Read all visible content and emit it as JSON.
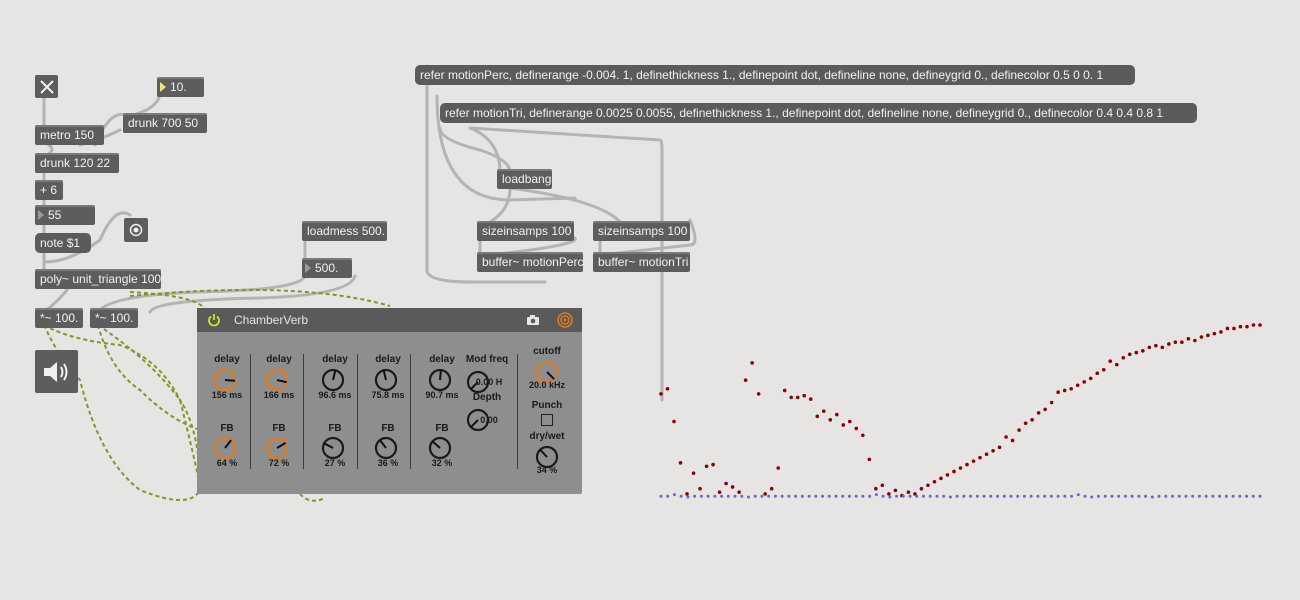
{
  "objects": {
    "toggle_icon": "x-toggle-icon",
    "number_10": "10.",
    "metro": "metro 150",
    "drunk_700": "drunk 700 50",
    "drunk_120": "drunk 120 22",
    "plus6": "+ 6",
    "number_55": "55",
    "note": "note $1",
    "bang_icon": "bang-icon",
    "loadmess": "loadmess 500.",
    "number_500": "500.",
    "poly": "poly~ unit_triangle 100",
    "mult1": "*~ 100.",
    "mult2": "*~ 100.",
    "speaker_icon": "speaker-icon",
    "msg_perc": "refer motionPerc, definerange -0.004. 1, definethickness 1., definepoint dot, defineline none, defineygrid 0., definecolor 0.5 0 0. 1",
    "msg_tri": "refer motionTri, definerange 0.0025 0.0055, definethickness 1., definepoint dot, defineline none, defineygrid 0., definecolor 0.4 0.4 0.8 1",
    "loadbang": "loadbang",
    "sizeinsamps1": "sizeinsamps 100",
    "sizeinsamps2": "sizeinsamps 100",
    "buffer_perc": "buffer~ motionPerc",
    "buffer_tri": "buffer~ motionTri"
  },
  "chamberverb": {
    "title": "ChamberVerb",
    "power_icon": "power-icon",
    "camera_icon": "camera-icon",
    "cycling_icon": "cycling74-icon",
    "accent": "#e07a1f",
    "delays": [
      {
        "label": "delay",
        "value": "156 ms",
        "fb_label": "FB",
        "fb_value": "64 %",
        "pos": 0.85,
        "fb_pos": 0.64
      },
      {
        "label": "delay",
        "value": "166 ms",
        "fb_label": "FB",
        "fb_value": "72 %",
        "pos": 0.88,
        "fb_pos": 0.72
      },
      {
        "label": "delay",
        "value": "96.6 ms",
        "fb_label": "FB",
        "fb_value": "27 %",
        "pos": 0.55,
        "fb_pos": 0.27
      },
      {
        "label": "delay",
        "value": "75.8 ms",
        "fb_label": "FB",
        "fb_value": "36 %",
        "pos": 0.45,
        "fb_pos": 0.36
      },
      {
        "label": "delay",
        "value": "90.7 ms",
        "fb_label": "FB",
        "fb_value": "32 %",
        "pos": 0.52,
        "fb_pos": 0.32
      }
    ],
    "mod_freq_label": "Mod freq",
    "mod_freq_value": "0.00 H",
    "depth_label": "Depth",
    "depth_value": "0.00",
    "cutoff_label": "cutoff",
    "cutoff_value": "20.0 kHz",
    "punch_label": "Punch",
    "drywet_label": "dry/wet",
    "drywet_value": "34 %",
    "drywet_pos": 0.34,
    "cutoff_pos": 1.0
  },
  "plot": {
    "perc_color": "#8b0000",
    "tri_color": "#6666cc",
    "range": [
      -0.004,
      1
    ],
    "perc_values": [
      0.6,
      0.63,
      0.44,
      0.2,
      0.02,
      0.14,
      0.05,
      0.18,
      0.19,
      0.03,
      0.08,
      0.06,
      0.03,
      0.68,
      0.78,
      0.6,
      0.02,
      0.05,
      0.17,
      0.62,
      0.58,
      0.58,
      0.59,
      0.57,
      0.47,
      0.5,
      0.45,
      0.48,
      0.42,
      0.44,
      0.4,
      0.36,
      0.22,
      0.05,
      0.07,
      0.02,
      0.04,
      0.01,
      0.03,
      0.02,
      0.05,
      0.07,
      0.09,
      0.11,
      0.13,
      0.15,
      0.17,
      0.19,
      0.21,
      0.23,
      0.25,
      0.27,
      0.29,
      0.35,
      0.33,
      0.39,
      0.43,
      0.45,
      0.49,
      0.51,
      0.55,
      0.61,
      0.62,
      0.63,
      0.65,
      0.67,
      0.69,
      0.72,
      0.74,
      0.79,
      0.77,
      0.81,
      0.83,
      0.84,
      0.85,
      0.87,
      0.88,
      0.87,
      0.89,
      0.9,
      0.9,
      0.92,
      0.91,
      0.93,
      0.94,
      0.95,
      0.96,
      0.98,
      0.98,
      0.99,
      0.99,
      1.0,
      1.0
    ],
    "tri_values": [
      0.0,
      0.0,
      0.01,
      0.0,
      -0.004,
      0.0,
      0.0,
      0.0,
      0.0,
      0.0,
      0.0,
      0.0,
      0.0,
      -0.004,
      0.0,
      0.0,
      0.0,
      0.0,
      0.0,
      0.0,
      0.0,
      0.0,
      0.0,
      0.0,
      0.0,
      0.0,
      0.0,
      0.0,
      0.0,
      0.0
    ]
  }
}
